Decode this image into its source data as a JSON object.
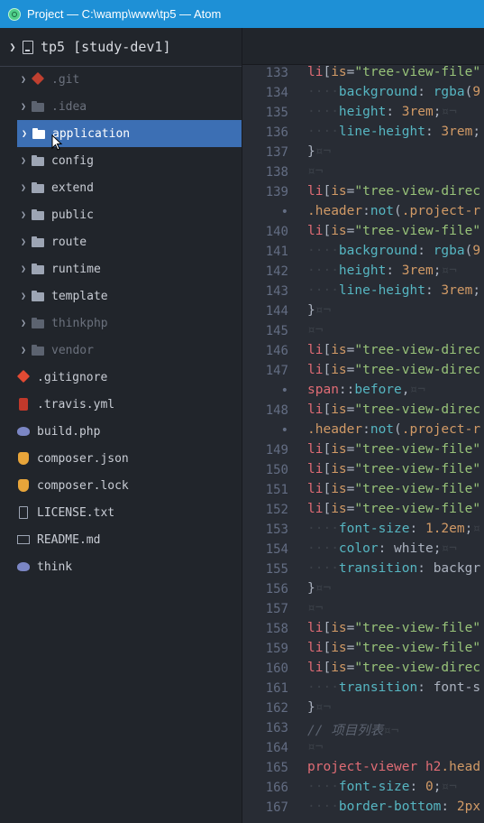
{
  "window": {
    "title": "Project — C:\\wamp\\www\\tp5 — Atom"
  },
  "tree": {
    "project": "tp5 [study-dev1]",
    "items": [
      {
        "label": ".git",
        "kind": "folder",
        "icon": "git-icon",
        "dim": true
      },
      {
        "label": ".idea",
        "kind": "folder",
        "icon": "folder-icon",
        "dim": true
      },
      {
        "label": "application",
        "kind": "folder",
        "icon": "folder-icon",
        "selected": true
      },
      {
        "label": "config",
        "kind": "folder",
        "icon": "folder-icon"
      },
      {
        "label": "extend",
        "kind": "folder",
        "icon": "folder-icon"
      },
      {
        "label": "public",
        "kind": "folder",
        "icon": "folder-icon"
      },
      {
        "label": "route",
        "kind": "folder",
        "icon": "folder-icon"
      },
      {
        "label": "runtime",
        "kind": "folder",
        "icon": "folder-icon"
      },
      {
        "label": "template",
        "kind": "folder",
        "icon": "folder-icon"
      },
      {
        "label": "thinkphp",
        "kind": "folder",
        "icon": "folder-icon",
        "dim": true
      },
      {
        "label": "vendor",
        "kind": "folder",
        "icon": "folder-icon",
        "dim": true
      },
      {
        "label": ".gitignore",
        "kind": "file",
        "icon": "git-icon"
      },
      {
        "label": ".travis.yml",
        "kind": "file",
        "icon": "travis-icon"
      },
      {
        "label": "build.php",
        "kind": "file",
        "icon": "php-icon"
      },
      {
        "label": "composer.json",
        "kind": "file",
        "icon": "composer-icon"
      },
      {
        "label": "composer.lock",
        "kind": "file",
        "icon": "composer-icon"
      },
      {
        "label": "LICENSE.txt",
        "kind": "file",
        "icon": "txt-icon"
      },
      {
        "label": "README.md",
        "kind": "file",
        "icon": "md-icon"
      },
      {
        "label": "think",
        "kind": "file",
        "icon": "think-icon"
      }
    ]
  },
  "editor": {
    "gutter": [
      "133",
      "134",
      "135",
      "136",
      "137",
      "138",
      "139",
      "•",
      "140",
      "141",
      "142",
      "143",
      "144",
      "145",
      "146",
      "147",
      "•",
      "148",
      "•",
      "149",
      "150",
      "151",
      "152",
      "153",
      "154",
      "155",
      "156",
      "157",
      "158",
      "159",
      "160",
      "161",
      "162",
      "163",
      "164",
      "165",
      "166",
      "167"
    ],
    "lines": [
      [
        [
          "tag",
          "li"
        ],
        [
          "txt",
          "["
        ],
        [
          "attr",
          "is"
        ],
        [
          "txt",
          "="
        ],
        [
          "str",
          "\"tree-view-file\""
        ]
      ],
      [
        [
          "ws",
          "····"
        ],
        [
          "prop",
          "background"
        ],
        [
          "txt",
          ": "
        ],
        [
          "fn",
          "rgba"
        ],
        [
          "txt",
          "("
        ],
        [
          "num",
          "9"
        ]
      ],
      [
        [
          "ws",
          "····"
        ],
        [
          "prop",
          "height"
        ],
        [
          "txt",
          ": "
        ],
        [
          "num",
          "3rem"
        ],
        [
          "txt",
          ";"
        ],
        [
          "ws",
          "¤¬"
        ]
      ],
      [
        [
          "ws",
          "····"
        ],
        [
          "prop",
          "line-height"
        ],
        [
          "txt",
          ": "
        ],
        [
          "num",
          "3rem"
        ],
        [
          "txt",
          ";"
        ]
      ],
      [
        [
          "txt",
          "}"
        ],
        [
          "ws",
          "¤¬"
        ]
      ],
      [
        [
          "ws",
          "¤¬"
        ]
      ],
      [
        [
          "tag",
          "li"
        ],
        [
          "txt",
          "["
        ],
        [
          "attr",
          "is"
        ],
        [
          "txt",
          "="
        ],
        [
          "str",
          "\"tree-view-direc"
        ]
      ],
      [
        [
          "cls",
          ".header"
        ],
        [
          "txt",
          ":"
        ],
        [
          "fn",
          "not"
        ],
        [
          "txt",
          "("
        ],
        [
          "cls",
          ".project-r"
        ]
      ],
      [
        [
          "tag",
          "li"
        ],
        [
          "txt",
          "["
        ],
        [
          "attr",
          "is"
        ],
        [
          "txt",
          "="
        ],
        [
          "str",
          "\"tree-view-file\""
        ]
      ],
      [
        [
          "ws",
          "····"
        ],
        [
          "prop",
          "background"
        ],
        [
          "txt",
          ": "
        ],
        [
          "fn",
          "rgba"
        ],
        [
          "txt",
          "("
        ],
        [
          "num",
          "9"
        ]
      ],
      [
        [
          "ws",
          "····"
        ],
        [
          "prop",
          "height"
        ],
        [
          "txt",
          ": "
        ],
        [
          "num",
          "3rem"
        ],
        [
          "txt",
          ";"
        ],
        [
          "ws",
          "¤¬"
        ]
      ],
      [
        [
          "ws",
          "····"
        ],
        [
          "prop",
          "line-height"
        ],
        [
          "txt",
          ": "
        ],
        [
          "num",
          "3rem"
        ],
        [
          "txt",
          ";"
        ]
      ],
      [
        [
          "txt",
          "}"
        ],
        [
          "ws",
          "¤¬"
        ]
      ],
      [
        [
          "ws",
          "¤¬"
        ]
      ],
      [
        [
          "tag",
          "li"
        ],
        [
          "txt",
          "["
        ],
        [
          "attr",
          "is"
        ],
        [
          "txt",
          "="
        ],
        [
          "str",
          "\"tree-view-direc"
        ]
      ],
      [
        [
          "tag",
          "li"
        ],
        [
          "txt",
          "["
        ],
        [
          "attr",
          "is"
        ],
        [
          "txt",
          "="
        ],
        [
          "str",
          "\"tree-view-direc"
        ]
      ],
      [
        [
          "tag",
          "span"
        ],
        [
          "txt",
          "::"
        ],
        [
          "fn",
          "before"
        ],
        [
          "txt",
          ","
        ],
        [
          "ws",
          "¤¬"
        ]
      ],
      [
        [
          "tag",
          "li"
        ],
        [
          "txt",
          "["
        ],
        [
          "attr",
          "is"
        ],
        [
          "txt",
          "="
        ],
        [
          "str",
          "\"tree-view-direc"
        ]
      ],
      [
        [
          "cls",
          ".header"
        ],
        [
          "txt",
          ":"
        ],
        [
          "fn",
          "not"
        ],
        [
          "txt",
          "("
        ],
        [
          "cls",
          ".project-r"
        ]
      ],
      [
        [
          "tag",
          "li"
        ],
        [
          "txt",
          "["
        ],
        [
          "attr",
          "is"
        ],
        [
          "txt",
          "="
        ],
        [
          "str",
          "\"tree-view-file\""
        ]
      ],
      [
        [
          "tag",
          "li"
        ],
        [
          "txt",
          "["
        ],
        [
          "attr",
          "is"
        ],
        [
          "txt",
          "="
        ],
        [
          "str",
          "\"tree-view-file\""
        ]
      ],
      [
        [
          "tag",
          "li"
        ],
        [
          "txt",
          "["
        ],
        [
          "attr",
          "is"
        ],
        [
          "txt",
          "="
        ],
        [
          "str",
          "\"tree-view-file\""
        ]
      ],
      [
        [
          "tag",
          "li"
        ],
        [
          "txt",
          "["
        ],
        [
          "attr",
          "is"
        ],
        [
          "txt",
          "="
        ],
        [
          "str",
          "\"tree-view-file\""
        ]
      ],
      [
        [
          "ws",
          "····"
        ],
        [
          "prop",
          "font-size"
        ],
        [
          "txt",
          ": "
        ],
        [
          "num",
          "1.2em"
        ],
        [
          "txt",
          ";"
        ],
        [
          "ws",
          "¤"
        ]
      ],
      [
        [
          "ws",
          "····"
        ],
        [
          "prop",
          "color"
        ],
        [
          "txt",
          ": "
        ],
        [
          "txt",
          "white"
        ],
        [
          "txt",
          ";"
        ],
        [
          "ws",
          "¤¬"
        ]
      ],
      [
        [
          "ws",
          "····"
        ],
        [
          "prop",
          "transition"
        ],
        [
          "txt",
          ": "
        ],
        [
          "txt",
          "backgr"
        ]
      ],
      [
        [
          "txt",
          "}"
        ],
        [
          "ws",
          "¤¬"
        ]
      ],
      [
        [
          "ws",
          "¤¬"
        ]
      ],
      [
        [
          "tag",
          "li"
        ],
        [
          "txt",
          "["
        ],
        [
          "attr",
          "is"
        ],
        [
          "txt",
          "="
        ],
        [
          "str",
          "\"tree-view-file\""
        ]
      ],
      [
        [
          "tag",
          "li"
        ],
        [
          "txt",
          "["
        ],
        [
          "attr",
          "is"
        ],
        [
          "txt",
          "="
        ],
        [
          "str",
          "\"tree-view-file\""
        ]
      ],
      [
        [
          "tag",
          "li"
        ],
        [
          "txt",
          "["
        ],
        [
          "attr",
          "is"
        ],
        [
          "txt",
          "="
        ],
        [
          "str",
          "\"tree-view-direc"
        ]
      ],
      [
        [
          "ws",
          "····"
        ],
        [
          "prop",
          "transition"
        ],
        [
          "txt",
          ": "
        ],
        [
          "txt",
          "font-s"
        ]
      ],
      [
        [
          "txt",
          "}"
        ],
        [
          "ws",
          "¤¬"
        ]
      ],
      [
        [
          "com",
          "// 项目列表"
        ],
        [
          "ws",
          "¤¬"
        ]
      ],
      [
        [
          "ws",
          "¤¬"
        ]
      ],
      [
        [
          "tag",
          "project-viewer"
        ],
        [
          "txt",
          " "
        ],
        [
          "tag",
          "h2"
        ],
        [
          "cls",
          ".head"
        ]
      ],
      [
        [
          "ws",
          "····"
        ],
        [
          "prop",
          "font-size"
        ],
        [
          "txt",
          ": "
        ],
        [
          "num",
          "0"
        ],
        [
          "txt",
          ";"
        ],
        [
          "ws",
          "¤¬"
        ]
      ],
      [
        [
          "ws",
          "····"
        ],
        [
          "prop",
          "border-bottom"
        ],
        [
          "txt",
          ": "
        ],
        [
          "num",
          "2px"
        ]
      ]
    ]
  }
}
